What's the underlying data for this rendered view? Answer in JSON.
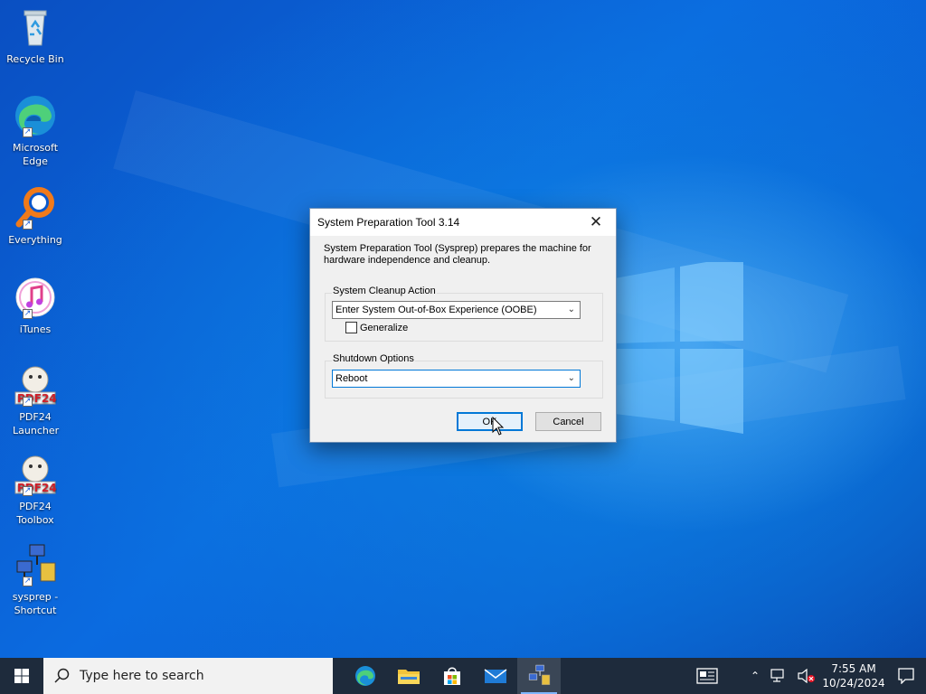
{
  "desktop": {
    "icons": [
      {
        "label": "Recycle Bin",
        "icon": "recycle-bin-icon"
      },
      {
        "label": "Microsoft Edge",
        "icon": "edge-icon"
      },
      {
        "label": "Everything",
        "icon": "everything-search-icon"
      },
      {
        "label": "iTunes",
        "icon": "itunes-icon"
      },
      {
        "label": "PDF24 Launcher",
        "icon": "pdf24-icon"
      },
      {
        "label": "PDF24 Toolbox",
        "icon": "pdf24-icon"
      },
      {
        "label": "sysprep - Shortcut",
        "icon": "sysprep-icon"
      }
    ]
  },
  "dialog": {
    "title": "System Preparation Tool 3.14",
    "description": "System Preparation Tool (Sysprep) prepares the machine for hardware independence and cleanup.",
    "cleanup_group_label": "System Cleanup Action",
    "cleanup_selected": "Enter System Out-of-Box Experience (OOBE)",
    "generalize_label": "Generalize",
    "generalize_checked": false,
    "shutdown_group_label": "Shutdown Options",
    "shutdown_selected": "Reboot",
    "ok_label": "OK",
    "cancel_label": "Cancel"
  },
  "taskbar": {
    "search_placeholder": "Type here to search",
    "pinned": [
      "edge-icon",
      "file-explorer-icon",
      "store-icon",
      "mail-icon",
      "sysprep-icon"
    ],
    "active_app": "sysprep-icon",
    "time": "7:55 AM",
    "date": "10/24/2024"
  },
  "colors": {
    "desktop_blue": "#0a63d8",
    "taskbar": "#1e2b3c",
    "accent": "#0078d7"
  }
}
